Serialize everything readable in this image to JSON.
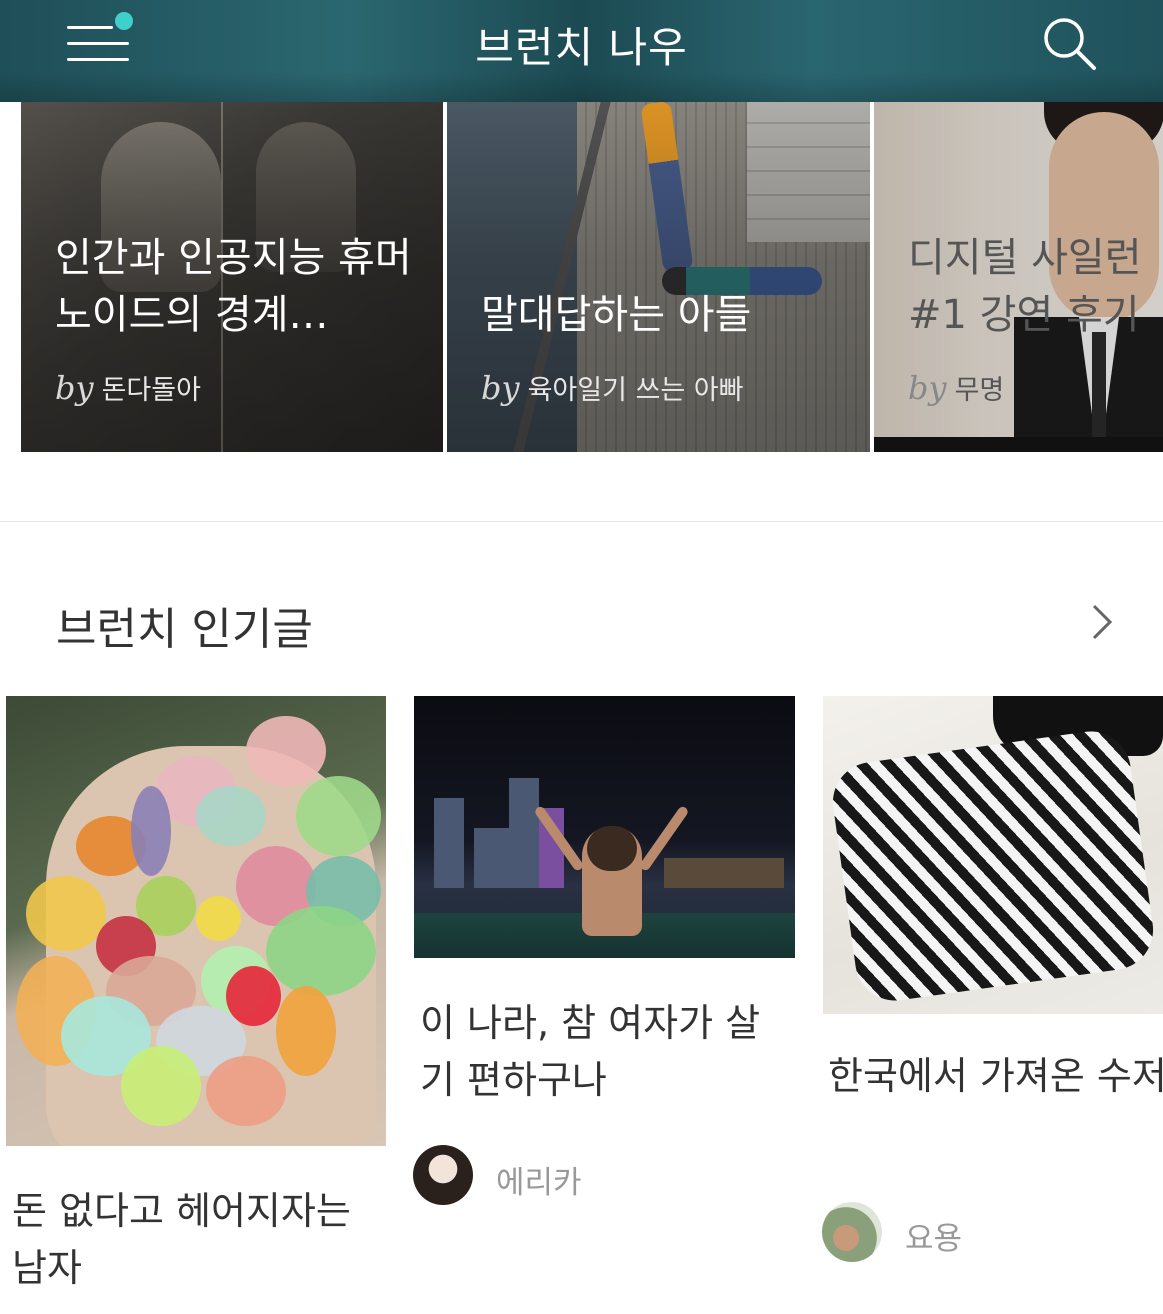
{
  "header": {
    "title": "브런치 나우",
    "menu_icon": "menu-icon",
    "search_icon": "search-icon",
    "accent_color": "#3fd0cc"
  },
  "featured": [
    {
      "title": "인간과 인공지능 휴머노이드의 경계…",
      "by": "by",
      "author": "돈다돌아"
    },
    {
      "title": "말대답하는 아들",
      "by": "by",
      "author": "육아일기 쓰는 아빠"
    },
    {
      "title": "디지털 사일런\n#1 강연 후기",
      "by": "by",
      "author": "무명"
    }
  ],
  "popular": {
    "heading": "브런치 인기글",
    "more_icon": "chevron-right-icon",
    "items": [
      {
        "title": "돈 없다고 헤어지자는\n남자",
        "author": ""
      },
      {
        "title": "이 나라, 참 여자가 살\n기 편하구나",
        "author": "에리카"
      },
      {
        "title": "한국에서 가져온 수저\n마스크에 대한 엇갈린",
        "author": "요용"
      }
    ]
  }
}
